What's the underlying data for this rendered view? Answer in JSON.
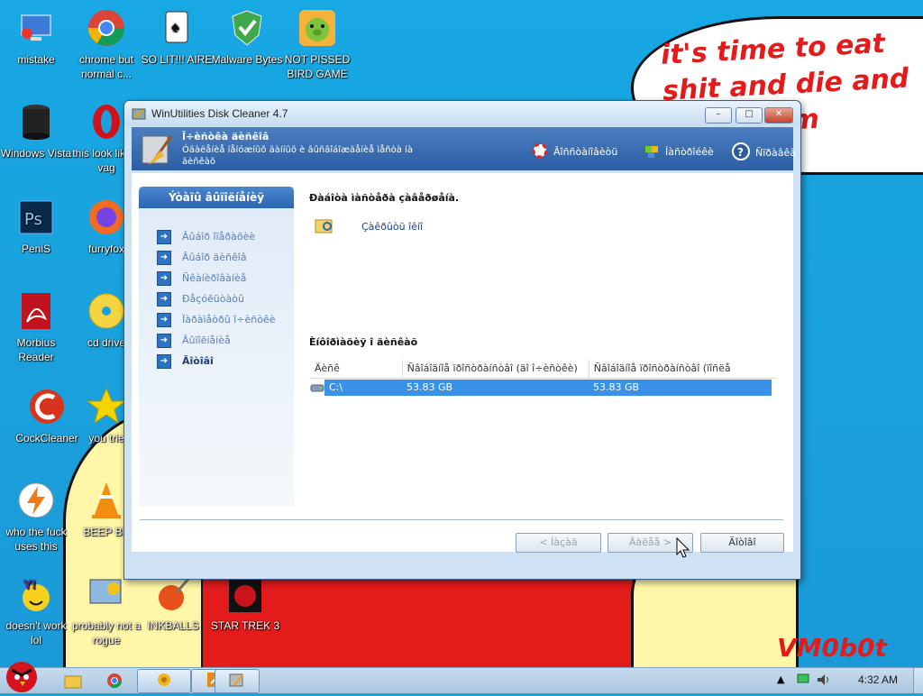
{
  "desktop": {
    "wallpaper_text": "it's time to eat shit and die and chew gum",
    "signature": "VM0b0t",
    "icons": [
      {
        "label": "mistake"
      },
      {
        "label": "chrome but normal c..."
      },
      {
        "label": "SO LIT!!! AIRE"
      },
      {
        "label": "Malware Bytes"
      },
      {
        "label": "NOT PISSED BIRD GAME"
      },
      {
        "label": "Windows Vista"
      },
      {
        "label": "this look like a vag"
      },
      {
        "label": "PeniS"
      },
      {
        "label": "furryfox"
      },
      {
        "label": "Morbius Reader"
      },
      {
        "label": "cd drive"
      },
      {
        "label": "CockCleaner"
      },
      {
        "label": "you trie"
      },
      {
        "label": "who the fuck uses this"
      },
      {
        "label": "BEEP BE"
      },
      {
        "label": "doesn't work lol"
      },
      {
        "label": "probably not a rogue"
      },
      {
        "label": "INKBALLS"
      },
      {
        "label": "STAR TREK 3"
      }
    ]
  },
  "dialog": {
    "title": "WinUtilities Disk Cleaner 4.7",
    "controls": {
      "minimize": "–",
      "maximize": "□",
      "close": "✕"
    },
    "banner": {
      "title": "Î÷èñòêà äèñêîâ",
      "subtitle": "Óäàëåíèå íåíóæíûõ äàííûõ è âûñâîáîæäåíèå ìåñòà íà äèñêàõ",
      "links": [
        {
          "label": "Âîññòàíîâèòü",
          "icon": "lifebuoy-icon"
        },
        {
          "label": "Íàñòðîéêè",
          "icon": "puzzle-icon"
        },
        {
          "label": "Ñïðàâêà",
          "icon": "help-icon"
        }
      ]
    },
    "left_panel": {
      "header": "Ýòàïû âûïîëíåíèÿ",
      "items": [
        {
          "label": "Âûáîð îïåðàöèè"
        },
        {
          "label": "Âûáîð äèñêîâ"
        },
        {
          "label": "Ñêàíèðîâàíèå"
        },
        {
          "label": "Ðåçóëüòàòû"
        },
        {
          "label": "Ïàðàìåòðû î÷èñòêè"
        },
        {
          "label": "Âûïîëíåíèå"
        },
        {
          "label": "Ãîòîâî"
        }
      ]
    },
    "drop_label": "Ðàáîòà ìàñòåðà çàâåðøåíà.",
    "drop_item": "Çàêðûòü îêíî",
    "source_label": "Èíôîðìàöèÿ î äèñêàõ",
    "table": {
      "columns": [
        "Äèñê",
        "Ñâîáîäíîå ïðîñòðàíñòâî (äî î÷èñòêè)",
        "Ñâîáîäíîå ïðîñòðàíñòâî (ïîñëå î÷èñòêè)"
      ],
      "rows": [
        {
          "drive": "C:\\",
          "before": "53.83 GB",
          "after": "53.83 GB"
        }
      ]
    },
    "buttons": {
      "back": "< Íàçàä",
      "next": "Äàëåå >",
      "finish": "Ãîòîâî"
    }
  },
  "taskbar": {
    "clock": "4:32 AM",
    "pinned": [
      "angry-birds-start-icon",
      "explorer-icon",
      "chrome-icon"
    ],
    "tray_arrow": "▲"
  }
}
